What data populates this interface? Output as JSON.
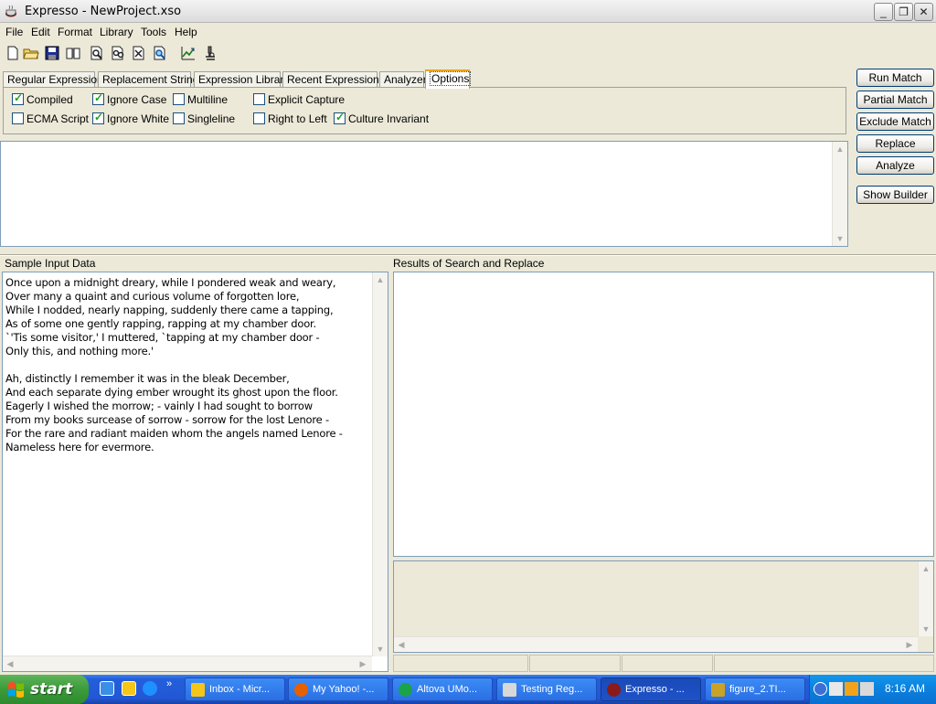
{
  "window": {
    "title": "Expresso - NewProject.xso"
  },
  "menu": [
    "File",
    "Edit",
    "Format",
    "Library",
    "Tools",
    "Help"
  ],
  "toolbar_icons": [
    "new-file-icon",
    "open-folder-icon",
    "save-icon",
    "library-book-icon",
    "find-icon",
    "find-next-icon",
    "replace-icon",
    "find-all-icon",
    "chart-icon",
    "microscope-icon"
  ],
  "tabs": [
    "Regular Expression",
    "Replacement String",
    "Expression Library",
    "Recent Expressions",
    "Analyzer",
    "Options"
  ],
  "active_tab": "Options",
  "options": {
    "compiled": {
      "label": "Compiled",
      "checked": true
    },
    "ignore_case": {
      "label": "Ignore Case",
      "checked": true
    },
    "multiline": {
      "label": "Multiline",
      "checked": false
    },
    "explicit_capture": {
      "label": "Explicit Capture",
      "checked": false
    },
    "ecma_script": {
      "label": "ECMA Script",
      "checked": false
    },
    "ignore_white": {
      "label": "Ignore White",
      "checked": true
    },
    "singleline": {
      "label": "Singleline",
      "checked": false
    },
    "right_to_left": {
      "label": "Right to Left",
      "checked": false
    },
    "culture_invariant": {
      "label": "Culture Invariant",
      "checked": true
    }
  },
  "buttons": {
    "run_match": "Run Match",
    "partial_match": "Partial Match",
    "exclude_match": "Exclude Match",
    "replace": "Replace",
    "analyze": "Analyze",
    "show_builder": "Show Builder"
  },
  "labels": {
    "sample_input": "Sample Input Data",
    "results": "Results of Search and Replace"
  },
  "sample_input_lines": [
    "Once upon a midnight dreary, while I pondered weak and weary,",
    "Over many a quaint and curious volume of forgotten lore,",
    "While I nodded, nearly napping, suddenly there came a tapping,",
    "As of some one gently rapping, rapping at my chamber door.",
    "`'Tis some visitor,' I muttered, `tapping at my chamber door -",
    "Only this, and nothing more.'",
    "",
    "Ah, distinctly I remember it was in the bleak December,",
    "And each separate dying ember wrought its ghost upon the floor.",
    "Eagerly I wished the morrow; - vainly I had sought to borrow",
    "From my books surcease of sorrow - sorrow for the lost Lenore -",
    "For the rare and radiant maiden whom the angels named Lenore -",
    "Nameless here for evermore."
  ],
  "taskbar": {
    "start": "start",
    "tasks": [
      {
        "label": "Inbox - Micr...",
        "icon": "outlook-icon",
        "color": "#f5c518"
      },
      {
        "label": "My Yahoo! -...",
        "icon": "firefox-icon",
        "color": "#e66000"
      },
      {
        "label": "Altova UMo...",
        "icon": "altova-icon",
        "color": "#1aa34a"
      },
      {
        "label": "Testing Reg...",
        "icon": "document-icon",
        "color": "#d8d8d8"
      },
      {
        "label": "Expresso - ...",
        "icon": "expresso-icon",
        "color": "#8b1a1a"
      },
      {
        "label": "figure_2.TI...",
        "icon": "image-icon",
        "color": "#c9a227"
      }
    ],
    "active_task_index": 4,
    "clock": "8:16 AM"
  }
}
